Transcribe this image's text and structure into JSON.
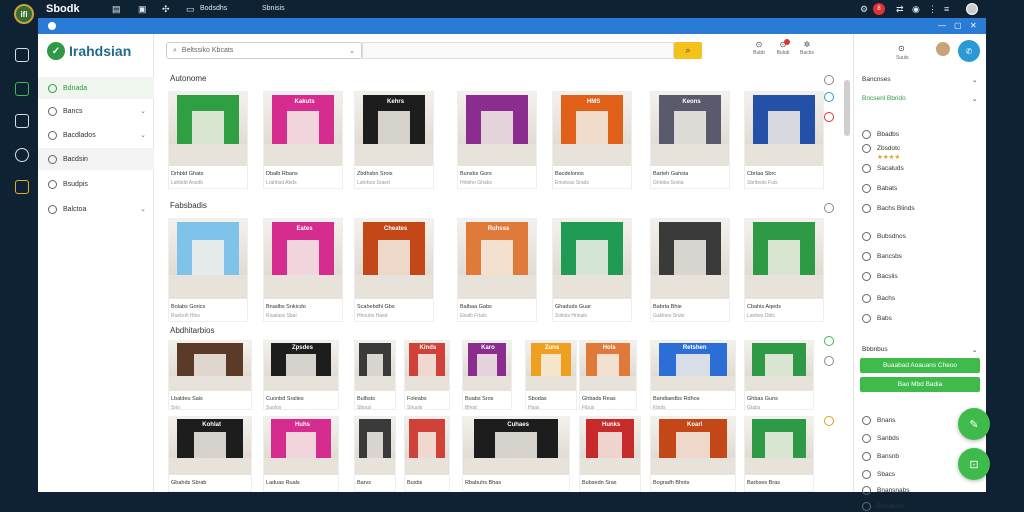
{
  "topbar": {
    "brand": "Sbodk",
    "icons": [
      "menu-icon",
      "image-icon",
      "pin-icon",
      "monitor-icon"
    ],
    "item1": "Bodsdhs",
    "item2": "Sbnisis",
    "notif_count": "8"
  },
  "sidebar": {
    "logo_text": "Irahdsian",
    "items": [
      {
        "label": "Bdnada",
        "state": "active"
      },
      {
        "label": "Bancs"
      },
      {
        "label": "Bacdlados"
      },
      {
        "label": "Bacdsin"
      },
      {
        "label": "Bsudpis"
      },
      {
        "label": "Balctoa"
      }
    ]
  },
  "header": {
    "search_placeholder": "Beltssiko Kbcats",
    "icons": [
      {
        "name": "cart-icon",
        "label": "Bubb"
      },
      {
        "name": "alert-icon",
        "label": "Bulub"
      },
      {
        "name": "settings-icon",
        "label": "Bacbs"
      }
    ]
  },
  "sections": [
    {
      "title": "Autonome",
      "cards": [
        {
          "cap": "Drhbld Ghats",
          "sub": "Lahbdd Aosdb",
          "sign": "",
          "color": "#2ea043"
        },
        {
          "cap": "Dbalb Rbans",
          "sub": "Lrahbsd Abds",
          "sign": "Kakuts",
          "color": "#d62b8f"
        },
        {
          "cap": "Zbdhsbn Srois",
          "sub": "Lahrbos Sraed",
          "sign": "Kehrs",
          "color": "#1d1d1d"
        },
        {
          "cap": "Bunsbs Gors",
          "sub": "Hinbho Ghabs",
          "sign": "",
          "color": "#8b2d8f"
        },
        {
          "cap": "Bacdelonos",
          "sub": "Emoleas Srads",
          "sign": "HMS",
          "color": "#e0601a"
        },
        {
          "cap": "Barteh Gansia",
          "sub": "Ghloba Sroita",
          "sign": "Keons",
          "color": "#5a5a6e"
        },
        {
          "cap": "Cbrlaa Sbrc",
          "sub": "Sbribods Fuls",
          "sign": "",
          "color": "#2550a8"
        }
      ]
    },
    {
      "title": "Fabsbadis",
      "cards": [
        {
          "cap": "Bolabs Gorics",
          "sub": "Rueboh Hlos",
          "sign": "",
          "color": "#7fc3ea"
        },
        {
          "cap": "Bnadbs Snkicdo",
          "sub": "Rluaiass Sbal",
          "sign": "Eates",
          "color": "#d62b8f"
        },
        {
          "cap": "Scahebdhl Gbs",
          "sub": "Hnoubs Haed",
          "sign": "Cheates",
          "color": "#c44718"
        },
        {
          "cap": "Balbaa Gabs",
          "sub": "Ebalb Frtals",
          "sign": "Ruhsss",
          "color": "#e07a3a"
        },
        {
          "cap": "Ghaduds Guar",
          "sub": "Soliots Hrinals",
          "sign": "",
          "color": "#1f9b55"
        },
        {
          "cap": "Babrta Bhie",
          "sub": "Gaklnes Sruts",
          "sign": "",
          "color": "#3a3a3a"
        },
        {
          "cap": "Cbahis Aqeds",
          "sub": "Lanbes Dbls",
          "sign": "",
          "color": "#2f9a45"
        }
      ]
    },
    {
      "title": "Abdhitarbios",
      "cards": [
        {
          "cap": "Lbaldeu Sais",
          "sub": "Srio",
          "sign": "",
          "color": "#5c3a28"
        },
        {
          "cap": "Cuonbd Sralies",
          "sub": "Suolos",
          "sign": "Zpsdes",
          "color": "#1d1d1d"
        },
        {
          "cap": "Bulbsts",
          "sub": "Sbous",
          "sign": "",
          "color": "#3a3a3a"
        },
        {
          "cap": "Foleabs",
          "sub": "Shuuls",
          "sign": "Kinds",
          "color": "#d0413a"
        },
        {
          "cap": "Buabs Sros",
          "sub": "Bhod",
          "sign": "Karo",
          "color": "#8b2d8f"
        },
        {
          "cap": "Sbodas",
          "sub": "Hsas",
          "sign": "Zuns",
          "color": "#f0a020"
        },
        {
          "cap": "Ghbads Reas",
          "sub": "Fibus",
          "sign": "Hois",
          "color": "#e07a3a"
        },
        {
          "cap": "Bandiaedbs Rdhos",
          "sub": "Kbols",
          "sign": "Retshen",
          "color": "#2b6fd6"
        },
        {
          "cap": "Ghbas Guns",
          "sub": "Gtabs",
          "sign": "",
          "color": "#2f9a45"
        }
      ]
    },
    {
      "title": "",
      "cards": [
        {
          "cap": "Gbahds Sbrab",
          "sub": "",
          "sign": "Kohlat",
          "color": "#1d1d1d"
        },
        {
          "cap": "Laduas Ruals",
          "sub": "",
          "sign": "Huhs",
          "color": "#d62b8f"
        },
        {
          "cap": "Barvs",
          "sub": "",
          "sign": "",
          "color": "#3a3a3a"
        },
        {
          "cap": "Busbs",
          "sub": "",
          "sign": "",
          "color": "#d0413a"
        },
        {
          "cap": "Rbabuhs Bhas",
          "sub": "",
          "sign": "Cuhaes",
          "color": "#1d1d1d"
        },
        {
          "cap": "Bubsedn Sras",
          "sub": "",
          "sign": "Hunks",
          "color": "#c72a2a"
        },
        {
          "cap": "Bogradh Bhots",
          "sub": "",
          "sign": "Koarl",
          "color": "#c44718"
        },
        {
          "cap": "Barbses Bras",
          "sub": "",
          "sign": "",
          "color": "#2f9a45"
        }
      ]
    }
  ],
  "rpanel": {
    "profile_label": "Suuls",
    "sec1_title": "Bancnses",
    "sec1_sub": "Bncsenl Bbrido",
    "rows": [
      "Bbadbs",
      "Zbsdotc",
      "Sacaluds",
      "Babats",
      "Bachs Blinds",
      "Bubsdnos",
      "Bancsbs",
      "Bacslis",
      "Bachs",
      "Babs"
    ],
    "stars": "★★★★",
    "sec2_title": "Bbbnbus",
    "btn1": "Buaabad Aoauans Cheoo",
    "btn2": "Bao Mbd Badia",
    "rows2": [
      "Bnans",
      "Sanbds",
      "Bansnb",
      "Sbacs",
      "Bnansnabs",
      "Banasms"
    ]
  }
}
